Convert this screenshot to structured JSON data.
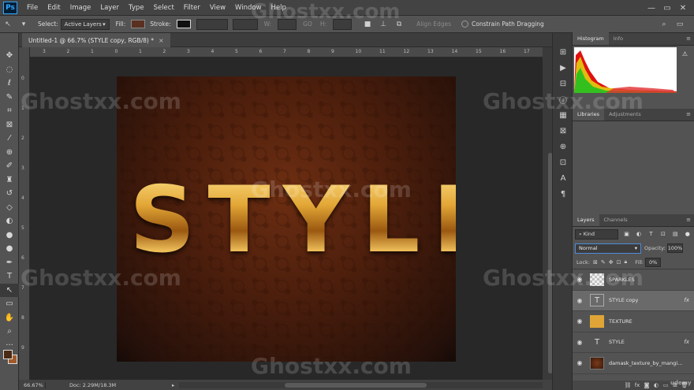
{
  "app": {
    "logo": "Ps",
    "menu": [
      "File",
      "Edit",
      "Image",
      "Layer",
      "Type",
      "Select",
      "Filter",
      "View",
      "Window",
      "Help"
    ],
    "window_controls": [
      "—",
      "▭",
      "✕"
    ]
  },
  "options": {
    "select_label": "Select:",
    "select_value": "Active Layers",
    "fill_label": "Fill:",
    "stroke_label": "Stroke:",
    "dim_labels": [
      "W:",
      "GO",
      "H:"
    ],
    "align_edges": "Align Edges",
    "constrain": "Constrain Path Dragging",
    "fill_color": "#5a3120",
    "stroke_color": "#111111"
  },
  "document": {
    "tab_title": "Untitled-1 @ 66.7% (STYLE copy, RGB/8) *",
    "close": "×",
    "ruler_h": [
      "3",
      "2",
      "1",
      "0",
      "1",
      "2",
      "3",
      "4",
      "5",
      "6",
      "7",
      "8",
      "9",
      "10",
      "11",
      "12",
      "13",
      "14",
      "15",
      "16",
      "17"
    ],
    "ruler_v": [
      "0",
      "1",
      "2",
      "3",
      "4",
      "5",
      "6",
      "7",
      "8",
      "9"
    ],
    "canvas_text": "STYLE"
  },
  "status": {
    "zoom": "66.67%",
    "doc": "Doc: 2.29M/18.3M",
    "arrow": "▸"
  },
  "panels": {
    "histogram_tabs": [
      "Histogram",
      "Info"
    ],
    "histogram_warning": "⚠",
    "libraries_tabs": [
      "Libraries",
      "Adjustments"
    ],
    "layers_tabs": [
      "Layers",
      "Channels"
    ],
    "kind": "Kind",
    "blend_mode": "Normal",
    "opacity_label": "Opacity:",
    "opacity_value": "100%",
    "lock_label": "Lock:",
    "fill_label": "Fill:",
    "fill_value": "0%",
    "layers": [
      {
        "name": "SPARKLES",
        "thumb": "checker",
        "fx": ""
      },
      {
        "name": "STYLE copy",
        "thumb": "text",
        "fx": "fx"
      },
      {
        "name": "TEXTURE",
        "thumb": "texture",
        "fx": ""
      },
      {
        "name": "STYLE",
        "thumb": "text",
        "fx": "fx"
      },
      {
        "name": "damask_texture_by_mangi...",
        "thumb": "damask",
        "fx": ""
      }
    ]
  },
  "watermark": "Ghostxx.com",
  "watermark_corner": "udemy"
}
